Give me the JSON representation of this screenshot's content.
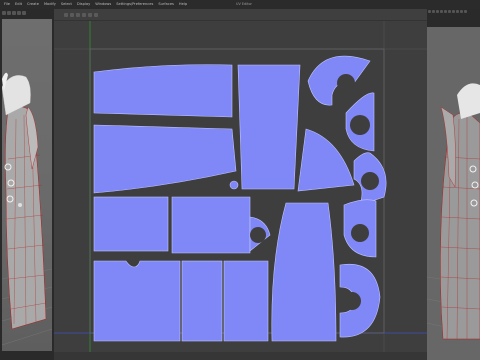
{
  "menu": [
    "File",
    "Edit",
    "Create",
    "Modify",
    "Select",
    "Display",
    "Windows",
    "Settings/Preferences",
    "Surfaces",
    "Help"
  ],
  "window_title": "UV Editor",
  "viewport_left": {
    "view": "3D perspective view"
  },
  "viewport_right": {
    "view": "3D perspective view"
  },
  "colors": {
    "uv_fill": "#8088f7",
    "uv_edge": "#bfc3ff",
    "grid": "#6b6b6b",
    "wire": "#b61e1e",
    "background": "#3e3e3e"
  }
}
